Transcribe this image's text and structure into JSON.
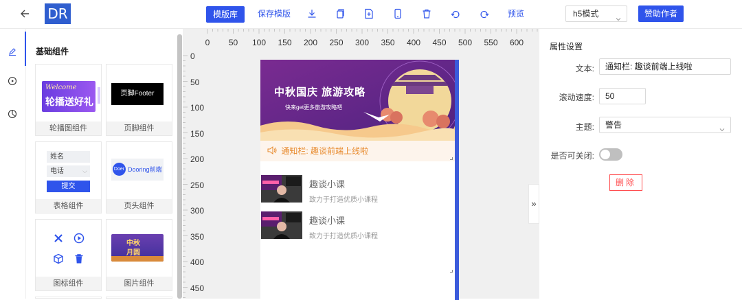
{
  "header": {
    "logo": "DR",
    "template_library": "模版库",
    "save_template": "保存模版",
    "preview": "预览",
    "mode_select": "h5模式",
    "sponsor": "赞助作者",
    "tools": [
      "download-icon",
      "copy-icon",
      "file-icon",
      "mobile-icon",
      "delete-icon",
      "undo-icon",
      "redo-icon"
    ]
  },
  "rail": {
    "items": [
      "edit-icon",
      "play-circle-icon",
      "pie-chart-icon"
    ]
  },
  "panel": {
    "title": "基础组件",
    "cards": [
      {
        "label": "轮播图组件",
        "preview_text": "轮播送好礼",
        "preview_script": "Welcome"
      },
      {
        "label": "页脚组件",
        "preview_text": "页脚Footer"
      },
      {
        "label": "表格组件",
        "field1": "姓名",
        "field2": "电话",
        "submit": "提交"
      },
      {
        "label": "页头组件",
        "badge": "Doer",
        "preview_text": "Dooring前端"
      },
      {
        "label": "图标组件"
      },
      {
        "label": "图片组件",
        "preview_text1": "中秋",
        "preview_text2": "月圆"
      }
    ]
  },
  "ruler": {
    "x": [
      "0",
      "50",
      "100",
      "150",
      "200",
      "250",
      "300",
      "350",
      "400",
      "450",
      "500",
      "550",
      "600"
    ],
    "y": [
      "0",
      "50",
      "100",
      "150",
      "200",
      "250",
      "300",
      "350",
      "400",
      "450"
    ]
  },
  "phone": {
    "banner_title": "中秋国庆 旅游攻略",
    "banner_sub": "快来get更多旅游攻略吧",
    "notice": "通知栏: 趣谈前端上线啦",
    "courses": [
      {
        "title": "趣谈小课",
        "subtitle": "致力于打造优质小课程"
      },
      {
        "title": "趣谈小课",
        "subtitle": "致力于打造优质小课程"
      }
    ]
  },
  "collapse": "»",
  "props": {
    "title": "属性设置",
    "text_label": "文本:",
    "text_value": "通知栏: 趣谈前端上线啦",
    "speed_label": "滚动速度:",
    "speed_value": "50",
    "theme_label": "主题:",
    "theme_value": "警告",
    "closable_label": "是否可关闭:",
    "closable": false,
    "delete": "删除"
  },
  "colors": {
    "primary": "#2f54eb",
    "danger": "#ff4d4f",
    "notice_text": "#e88a2d",
    "banner_purple": "#6b2c91"
  }
}
